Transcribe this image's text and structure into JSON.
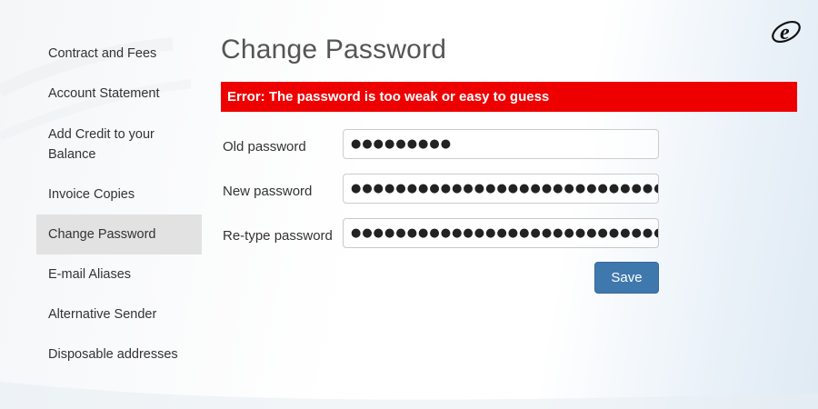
{
  "sidebar": {
    "items": [
      {
        "label": "Contract and Fees"
      },
      {
        "label": "Account Statement"
      },
      {
        "label": "Add Credit to your Balance"
      },
      {
        "label": "Invoice Copies"
      },
      {
        "label": "Change Password",
        "active": true
      },
      {
        "label": "E-mail Aliases"
      },
      {
        "label": "Alternative Sender"
      },
      {
        "label": "Disposable addresses"
      }
    ]
  },
  "main": {
    "title": "Change Password",
    "error": "Error: The password is too weak or easy to guess",
    "fields": [
      {
        "label": "Old password",
        "value": "●●●●●●●●●"
      },
      {
        "label": "New password",
        "value": "●●●●●●●●●●●●●●●●●●●●●●●●●●●●●●"
      },
      {
        "label": "Re-type password",
        "value": "●●●●●●●●●●●●●●●●●●●●●●●●●●●●●●"
      }
    ],
    "save_label": "Save"
  },
  "logo": {
    "letter": "e",
    "icon": "brand-logo-icon"
  },
  "colors": {
    "error_bg": "#ee0000",
    "button_bg": "#3f78ad",
    "active_item_bg": "#e2e2e2"
  }
}
